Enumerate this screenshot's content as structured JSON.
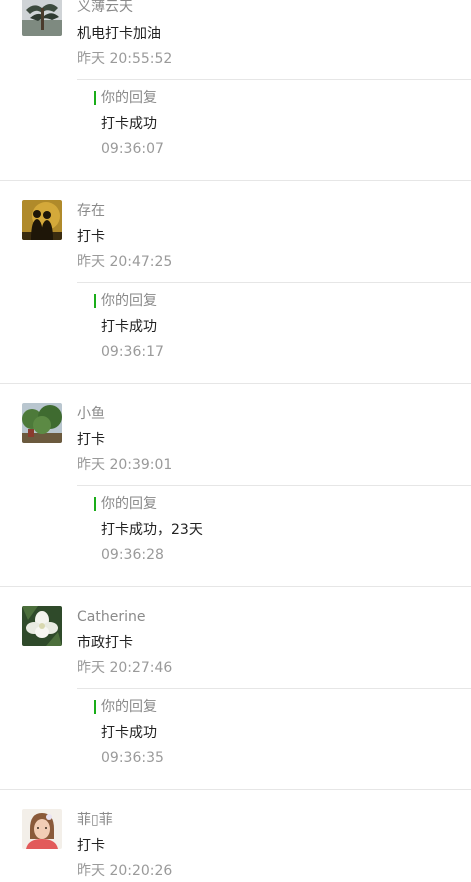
{
  "comments": [
    {
      "nickname": "义薄云天",
      "content": "机电打卡加油",
      "time": "昨天 20:55:52",
      "avatar": "pine-tree-avatar",
      "reply": {
        "label": "你的回复",
        "content": "打卡成功",
        "time": "09:36:07"
      }
    },
    {
      "nickname": "存在",
      "content": "打卡",
      "time": "昨天 20:47:25",
      "avatar": "silhouette-couple-avatar",
      "reply": {
        "label": "你的回复",
        "content": "打卡成功",
        "time": "09:36:17"
      }
    },
    {
      "nickname": "小鱼",
      "content": "打卡",
      "time": "昨天 20:39:01",
      "avatar": "green-trees-avatar",
      "reply": {
        "label": "你的回复",
        "content": "打卡成功，23天",
        "time": "09:36:28"
      }
    },
    {
      "nickname": "Catherine",
      "content": "市政打卡",
      "time": "昨天 20:27:46",
      "avatar": "white-flower-avatar",
      "reply": {
        "label": "你的回复",
        "content": "打卡成功",
        "time": "09:36:35"
      }
    },
    {
      "nickname": "菲▯菲",
      "content": "打卡",
      "time": "昨天 20:20:26",
      "avatar": "girl-portrait-avatar"
    }
  ],
  "colors": {
    "reply_bar": "#1aad19",
    "divider": "#e6e6e6",
    "meta_text": "#9a9a9a"
  }
}
